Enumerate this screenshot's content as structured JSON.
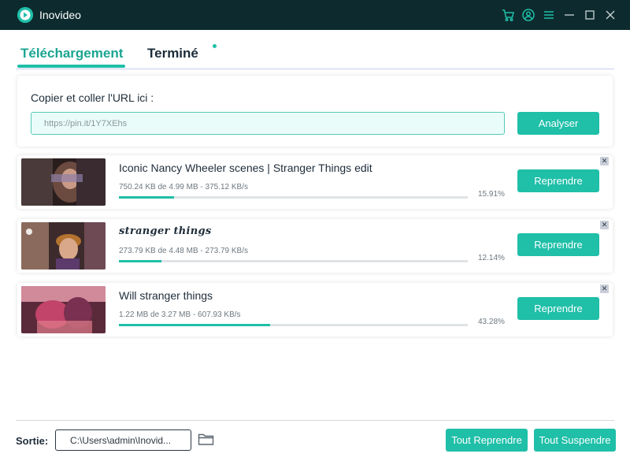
{
  "app": {
    "title": "Inovideo"
  },
  "titlebar": {
    "icons": [
      "cart-icon",
      "account-icon",
      "menu-icon",
      "minimize-icon",
      "maximize-icon",
      "close-icon"
    ]
  },
  "tabs": [
    {
      "label": "Téléchargement",
      "active": true
    },
    {
      "label": "Terminé",
      "active": false,
      "has_dot": true
    }
  ],
  "url_box": {
    "label": "Copier et coller l'URL ici :",
    "value": "https://pin.it/1Y7XEhs",
    "button": "Analyser"
  },
  "downloads": [
    {
      "title": "Iconic Nancy Wheeler scenes | Stranger Things edit",
      "meta": "750.24 KB de 4.99 MB - 375.12 KB/s",
      "percent_label": "15.91%",
      "progress": 0.1591,
      "button": "Reprendre"
    },
    {
      "title": "stranger things",
      "meta": "273.79 KB de 4.48 MB - 273.79 KB/s",
      "percent_label": "12.14%",
      "progress": 0.1214,
      "button": "Reprendre"
    },
    {
      "title": "Will stranger things",
      "meta": "1.22 MB de 3.27 MB - 607.93 KB/s",
      "percent_label": "43.28%",
      "progress": 0.4328,
      "button": "Reprendre"
    }
  ],
  "footer": {
    "output_label": "Sortie:",
    "output_path": "C:\\Users\\admin\\Inovid...",
    "resume_all": "Tout Reprendre",
    "suspend_all": "Tout Suspendre"
  },
  "colors": {
    "titlebar_bg": "#0d2b2e",
    "accent": "#1fbfa8",
    "tab_active_text": "#1aa591"
  }
}
